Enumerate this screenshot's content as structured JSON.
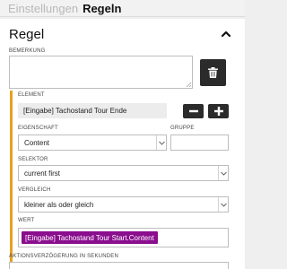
{
  "tabs": {
    "inactive": "Einstellungen",
    "active": "Regeln"
  },
  "panel": {
    "title": "Regel"
  },
  "bemerkung": {
    "label": "BEMERKUNG",
    "value": ""
  },
  "element": {
    "label": "ELEMENT",
    "value": "[Eingabe] Tachostand Tour Ende"
  },
  "eigenschaft": {
    "label": "EIGENSCHAFT",
    "value": "Content"
  },
  "gruppe": {
    "label": "GRUPPE",
    "value": ""
  },
  "selektor": {
    "label": "SELEKTOR",
    "value": "current first"
  },
  "vergleich": {
    "label": "VERGLEICH",
    "value": "kleiner als oder gleich"
  },
  "wert": {
    "label": "WERT",
    "chip": "[Eingabe] Tachostand Tour Start.Content"
  },
  "aktionsverzoegerung": {
    "label": "AKTIONSVERZÖGERUNG IN SEKUNDEN"
  },
  "icons": {
    "collapse": "chevron-up-icon",
    "delete": "trash-icon",
    "remove": "minus-icon",
    "add": "plus-icon",
    "dropdown": "chevron-down-icon"
  },
  "colors": {
    "accent_bar": "#e8a020",
    "chip": "#8a0e8e",
    "button": "#2b2b2b"
  }
}
